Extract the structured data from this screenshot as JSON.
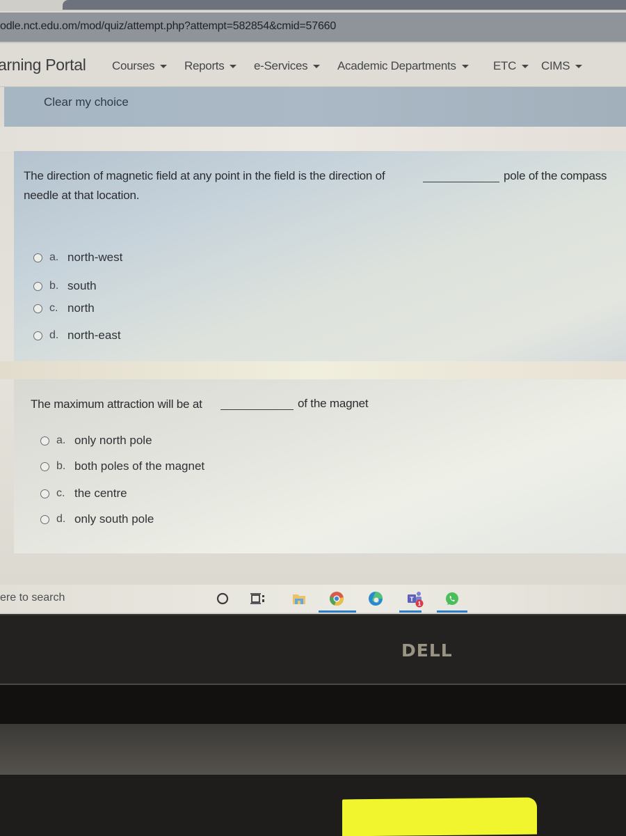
{
  "browser": {
    "url": "odle.nct.edu.om/mod/quiz/attempt.php?attempt=582854&cmid=57660"
  },
  "navbar": {
    "brand": "arning Portal",
    "menus": [
      {
        "label": "Courses",
        "icon": "caret-down-icon"
      },
      {
        "label": "Reports",
        "icon": "caret-down-icon"
      },
      {
        "label": "e-Services",
        "icon": "caret-down-icon"
      },
      {
        "label": "Academic Departments",
        "icon": "caret-down-icon"
      },
      {
        "label": "ETC",
        "icon": "caret-down-icon"
      },
      {
        "label": "CIMS",
        "icon": "caret-down-icon"
      }
    ]
  },
  "previous_question": {
    "clear_choice": "Clear my choice"
  },
  "questions": [
    {
      "text_before": "The direction of magnetic field at any point in the field is the direction of",
      "text_after": "pole of the compass",
      "text_line2": "needle at that location.",
      "options": [
        {
          "letter": "a.",
          "label": "north-west",
          "selected": false
        },
        {
          "letter": "b.",
          "label": "south",
          "selected": false
        },
        {
          "letter": "c.",
          "label": "north",
          "selected": false
        },
        {
          "letter": "d.",
          "label": "north-east",
          "selected": false
        }
      ]
    },
    {
      "text_before": "The maximum attraction will be at",
      "text_after": "of the magnet",
      "options": [
        {
          "letter": "a.",
          "label": "only north pole",
          "selected": false
        },
        {
          "letter": "b.",
          "label": "both poles of the magnet",
          "selected": false
        },
        {
          "letter": "c.",
          "label": "the centre",
          "selected": false
        },
        {
          "letter": "d.",
          "label": "only south pole",
          "selected": false
        }
      ]
    }
  ],
  "taskbar": {
    "search_text": "ere to search",
    "icons": [
      "cortana-icon",
      "task-view-icon",
      "file-explorer-icon",
      "chrome-icon",
      "edge-icon",
      "teams-icon",
      "whatsapp-icon"
    ],
    "teams_badge": "1"
  },
  "bezel": {
    "logo": "DELL"
  },
  "colors": {
    "panel_blue": "#a7b6c3",
    "sticky_note": "#f0f52e",
    "taskbar_active": "#2f7fc7"
  }
}
